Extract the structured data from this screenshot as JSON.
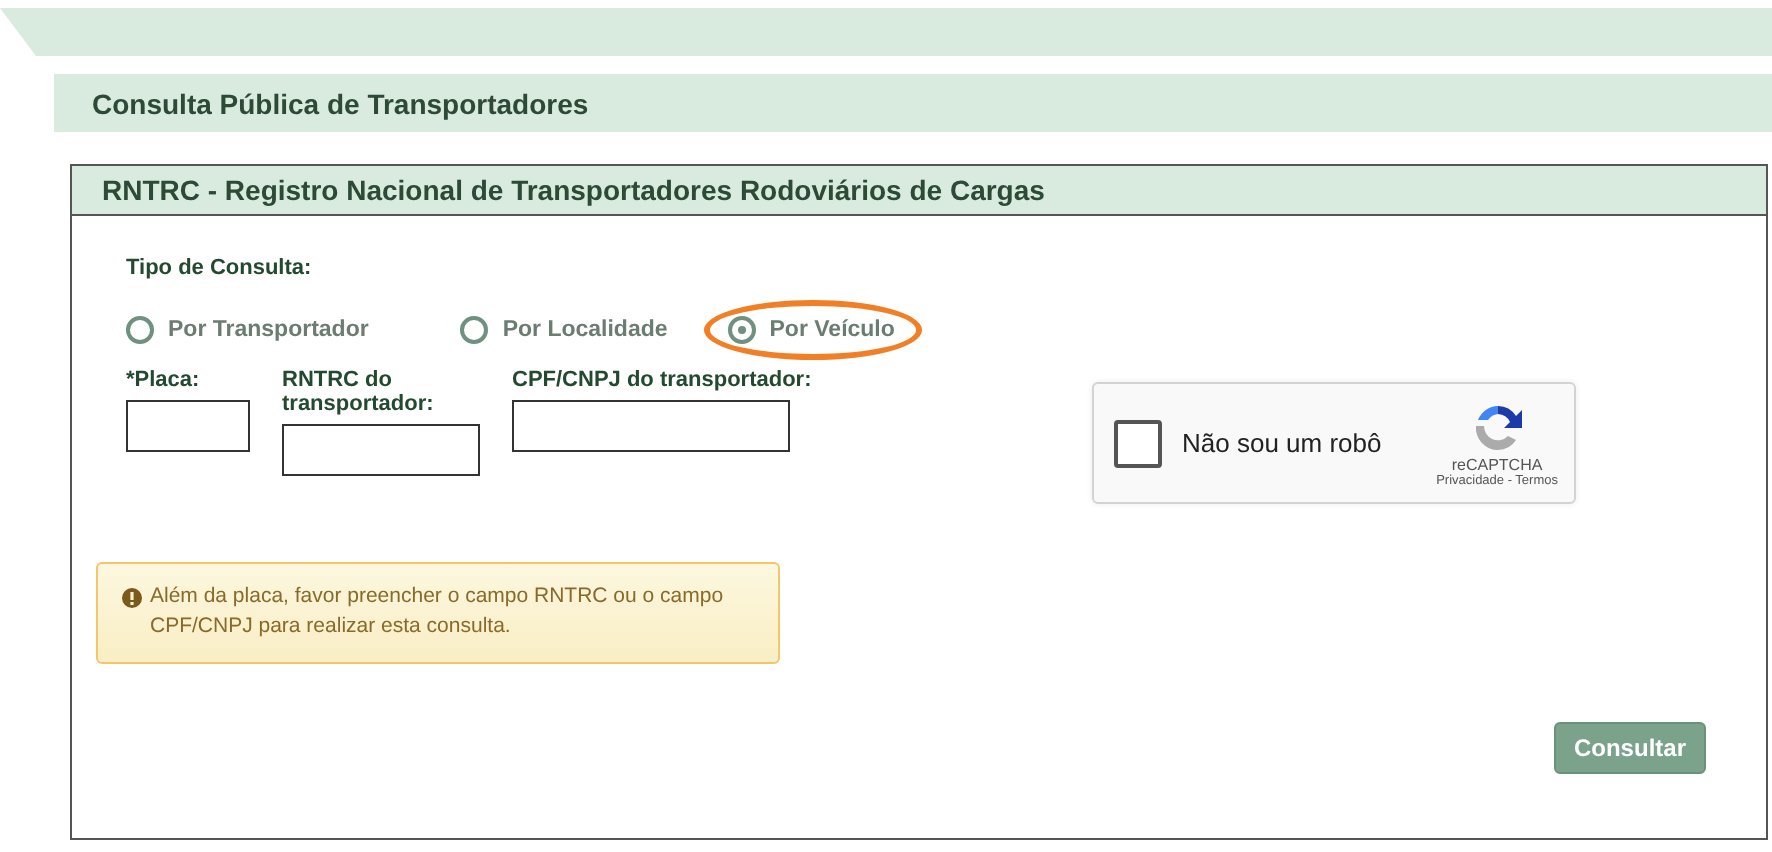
{
  "page_title": "Consulta Pública de Transportadores",
  "panel": {
    "title": "RNTRC - Registro Nacional de Transportadores Rodoviários de Cargas",
    "query_type_label": "Tipo de Consulta:",
    "options": [
      {
        "label": "Por Transportador",
        "selected": false,
        "highlighted": false
      },
      {
        "label": "Por Localidade",
        "selected": false,
        "highlighted": false
      },
      {
        "label": "Por Veículo",
        "selected": true,
        "highlighted": true
      }
    ],
    "fields": [
      {
        "label": "*Placa:"
      },
      {
        "label": "RNTRC do transportador:"
      },
      {
        "label": "CPF/CNPJ do transportador:"
      }
    ],
    "captcha": {
      "label": "Não sou um robô",
      "checked": false,
      "brand": "reCAPTCHA",
      "links": "Privacidade - Termos"
    },
    "alert": "Além da placa, favor preencher o campo RNTRC ou o campo CPF/CNPJ para realizar esta consulta.",
    "button": "Consultar"
  }
}
